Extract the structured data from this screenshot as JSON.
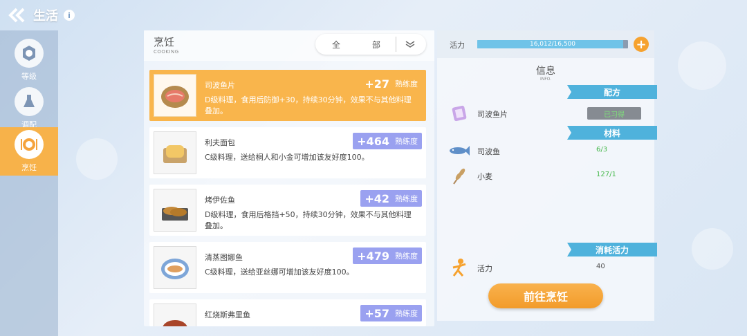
{
  "topbar": {
    "title": "生活",
    "info": "i"
  },
  "sidebar": {
    "items": [
      {
        "label": "等级",
        "icon": "level-icon"
      },
      {
        "label": "调配",
        "icon": "flask-icon"
      },
      {
        "label": "烹饪",
        "icon": "plate-cutlery-icon"
      }
    ]
  },
  "list": {
    "title": "烹饪",
    "subtitle": "COOKING",
    "filter": {
      "left": "全",
      "right": "部"
    },
    "recipes": [
      {
        "name": "司波鱼片",
        "desc": "D级料理，食用后防御+30，持续30分钟，效果不与其他料理叠加。",
        "xp": "+27",
        "xp_unit": "熟练度",
        "icon": "fish-slices-icon"
      },
      {
        "name": "利夫面包",
        "desc": "C级料理，送给桐人和小金可增加该友好度100。",
        "xp": "+464",
        "xp_unit": "熟练度",
        "icon": "bread-icon"
      },
      {
        "name": "烤伊佐鱼",
        "desc": "D级料理，食用后格挡+50，持续30分钟，效果不与其他料理叠加。",
        "xp": "+42",
        "xp_unit": "熟练度",
        "icon": "grilled-fish-icon"
      },
      {
        "name": "清蒸图娜鱼",
        "desc": "C级料理，送给亚丝娜可增加该友好度100。",
        "xp": "+479",
        "xp_unit": "熟练度",
        "icon": "steamed-fish-icon"
      },
      {
        "name": "红烧斯弗里鱼",
        "desc": "",
        "xp": "+57",
        "xp_unit": "熟练度",
        "icon": "braised-fish-icon"
      }
    ]
  },
  "info": {
    "stamina_label": "活力",
    "stamina_text": "16,012/16,500",
    "stamina_fraction": 0.97,
    "plus": "+",
    "title": "信息",
    "subtitle": "INFO.",
    "recipe_tag": "配方",
    "recipe_name": "司波鱼片",
    "recipe_status": "已习得",
    "materials_tag": "材料",
    "materials": [
      {
        "name": "司波鱼",
        "value": "6/3",
        "icon": "fish-icon"
      },
      {
        "name": "小麦",
        "value": "127/1",
        "icon": "wheat-icon"
      }
    ],
    "consume_tag": "消耗活力",
    "consume_name": "活力",
    "consume_value": "40",
    "cook_button": "前往烹饪"
  },
  "colors": {
    "accent": "#f7b24a",
    "tag_blue": "#4fb2dc",
    "xp_purple": "#9aa1f0"
  }
}
